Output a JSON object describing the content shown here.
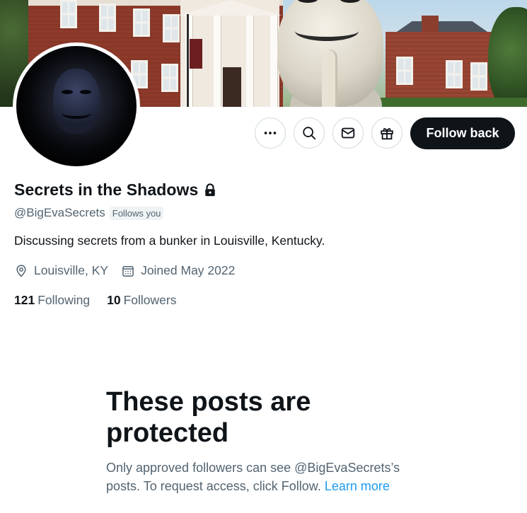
{
  "profile": {
    "display_name": "Secrets in the Shadows",
    "handle": "@BigEvaSecrets",
    "follows_you": "Follows you",
    "bio": "Discussing secrets from a bunker in Louisville, Kentucky.",
    "location": "Louisville, KY",
    "joined": "Joined May 2022",
    "following_count": "121",
    "following_label": "Following",
    "followers_count": "10",
    "followers_label": "Followers"
  },
  "actions": {
    "more_icon": "more-horizontal-icon",
    "search_icon": "search-icon",
    "message_icon": "mail-icon",
    "gift_icon": "gift-icon",
    "follow_label": "Follow back"
  },
  "protected": {
    "title": "These posts are protected",
    "desc_text": "Only approved followers can see @BigEvaSecrets’s posts. To request access, click Follow.",
    "learn_more": "Learn more"
  },
  "colors": {
    "primary_text": "#0f1419",
    "secondary_text": "#536471",
    "link": "#1d9bf0",
    "button_bg": "#0f1419"
  }
}
